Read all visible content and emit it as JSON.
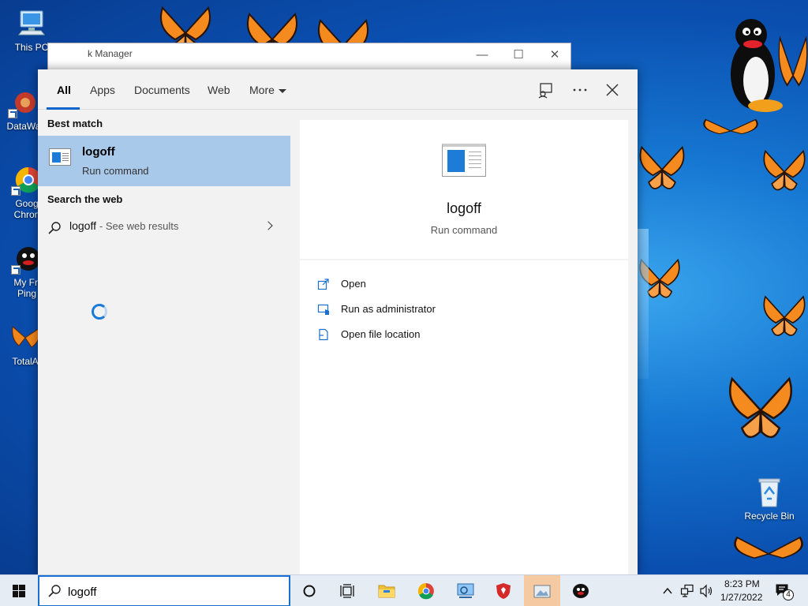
{
  "desktop": {
    "icons": [
      {
        "label": "This PC"
      },
      {
        "label": "DataWa"
      },
      {
        "label": "Goog Chron"
      },
      {
        "label": "My Fri Ping"
      },
      {
        "label": "TotalA"
      },
      {
        "label": "Recycle Bin"
      }
    ]
  },
  "bg_window": {
    "title": "k Manager",
    "minimize": "—",
    "maximize": "☐",
    "close": "✕"
  },
  "search_panel": {
    "tabs": [
      {
        "label": "All"
      },
      {
        "label": "Apps"
      },
      {
        "label": "Documents"
      },
      {
        "label": "Web"
      },
      {
        "label": "More"
      }
    ],
    "best_match_label": "Best match",
    "best_match": {
      "title": "logoff",
      "subtitle": "Run command"
    },
    "search_web_label": "Search the web",
    "web_result": {
      "query": "logoff",
      "suffix": "- See web results"
    },
    "preview": {
      "title": "logoff",
      "subtitle": "Run command"
    },
    "actions": [
      {
        "label": "Open",
        "icon": "open-icon"
      },
      {
        "label": "Run as administrator",
        "icon": "run-as-admin-icon"
      },
      {
        "label": "Open file location",
        "icon": "file-location-icon"
      }
    ]
  },
  "taskbar": {
    "search_value": "logoff",
    "clock_time": "8:23 PM",
    "clock_date": "1/27/2022",
    "notification_count": "4"
  },
  "colors": {
    "accent": "#0a64c9",
    "selection": "#a9c9ea",
    "panel_bg": "#f2f2f2"
  }
}
